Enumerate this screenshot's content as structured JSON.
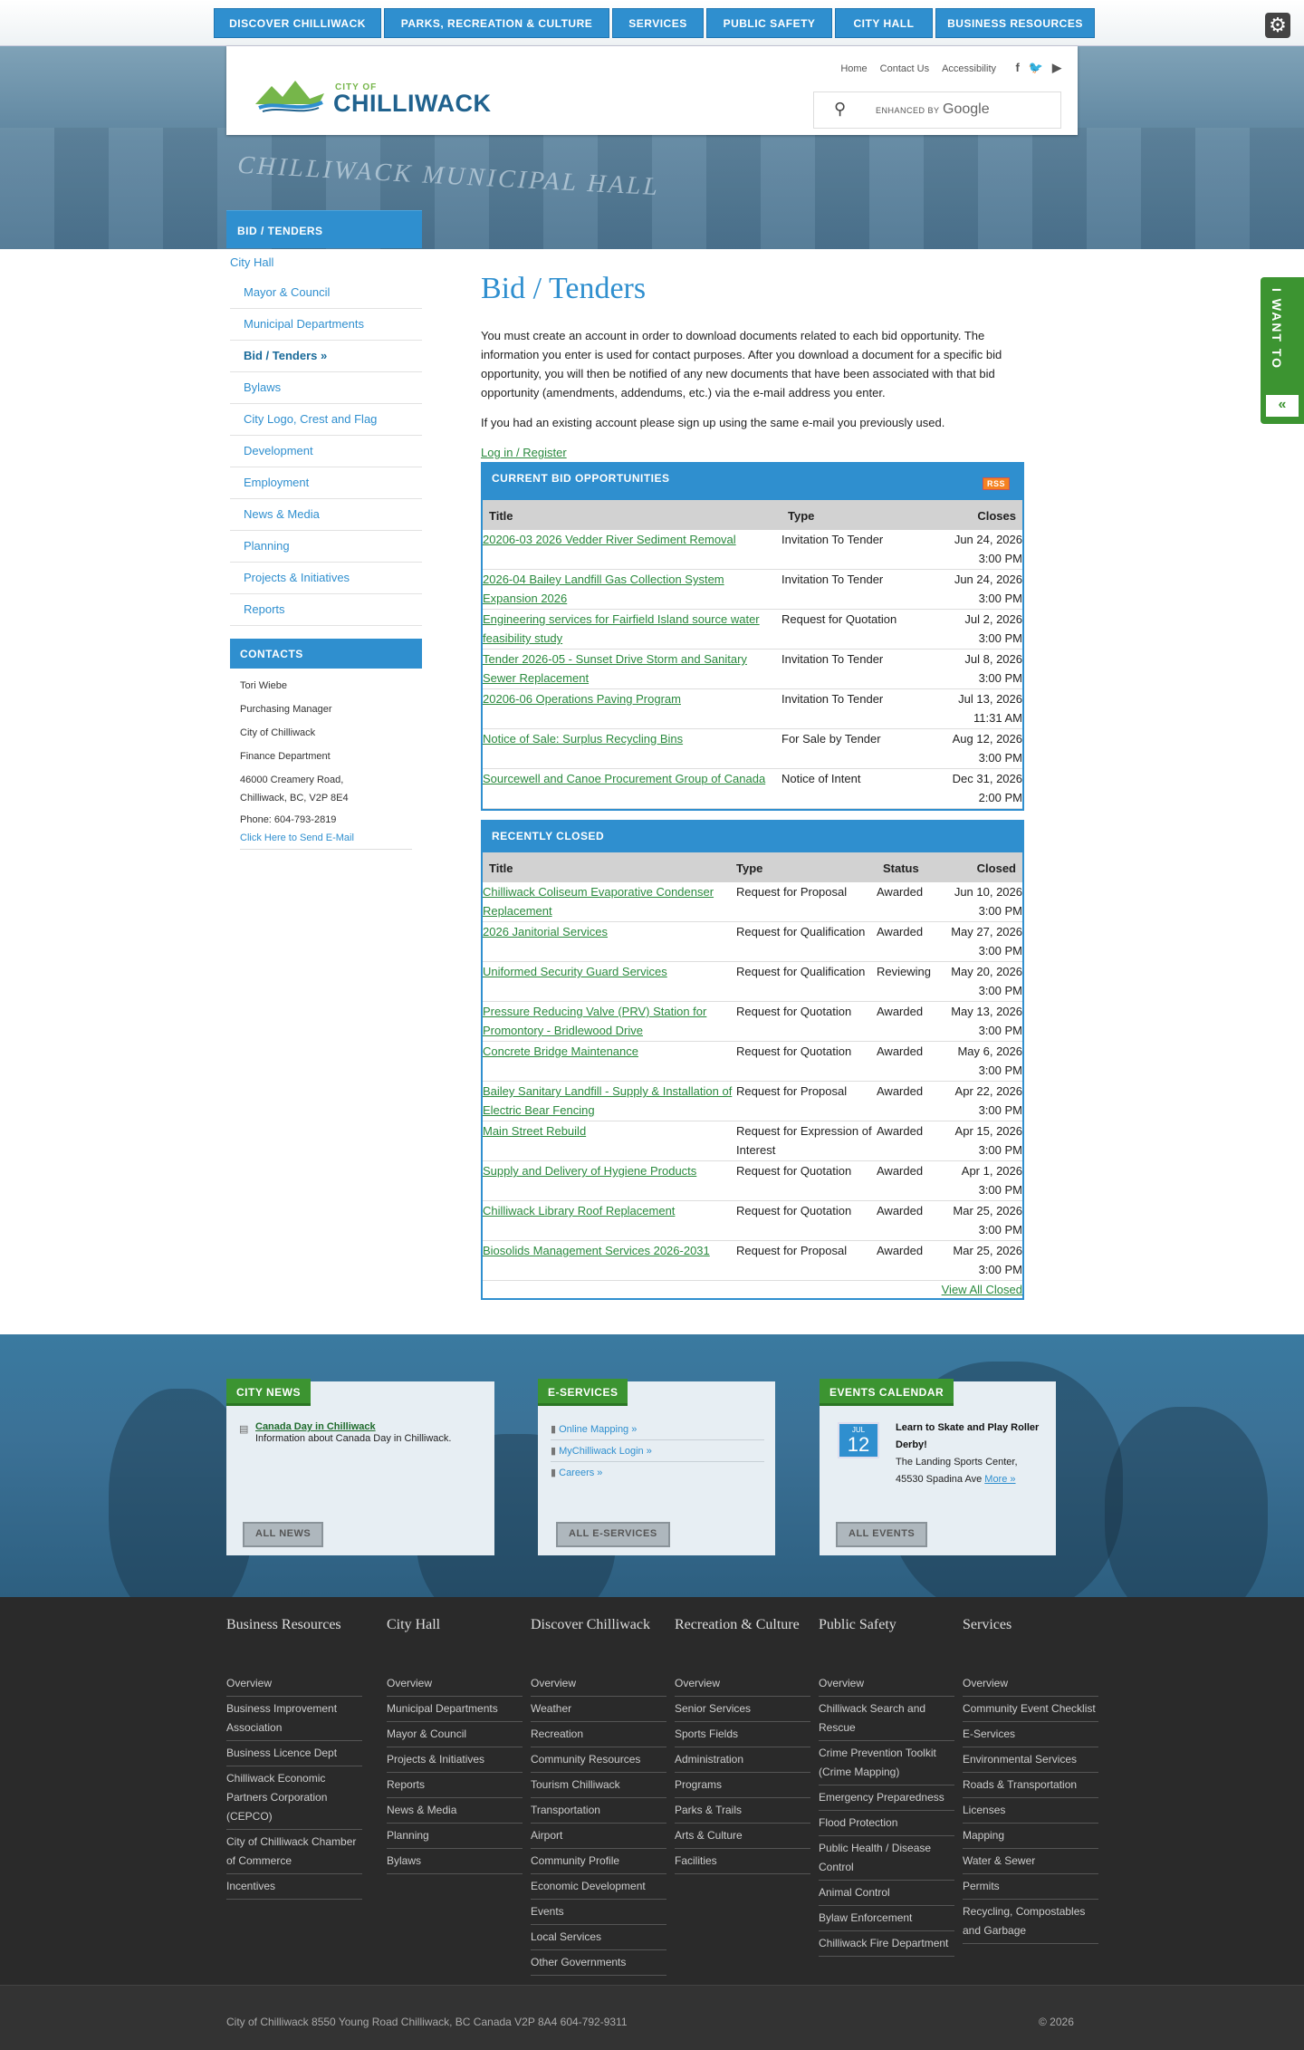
{
  "topnav": [
    "DISCOVER CHILLIWACK",
    "PARKS, RECREATION & CULTURE",
    "SERVICES",
    "PUBLIC SAFETY",
    "CITY HALL",
    "BUSINESS RESOURCES"
  ],
  "gear_icon": "gear-icon",
  "header": {
    "logo_small": "CITY OF",
    "logo_text": "CHILLIWACK",
    "util_links": [
      "Home",
      "Contact Us",
      "Accessibility"
    ],
    "socials": [
      "f",
      "t",
      "yt"
    ],
    "search_enhanced": "ENHANCED BY",
    "search_google": "Google"
  },
  "hero_sign": "CHILLIWACK MUNICIPAL HALL",
  "sidebar": {
    "header": "BID / TENDERS",
    "parent": "City Hall",
    "items": [
      "Mayor & Council",
      "Municipal Departments",
      "Bid / Tenders »",
      "Bylaws",
      "City Logo, Crest and Flag",
      "Development",
      "Employment",
      "News & Media",
      "Planning",
      "Projects & Initiatives",
      "Reports"
    ]
  },
  "contacts": {
    "header": "CONTACTS",
    "name": "Tori Wiebe",
    "role": "Purchasing Manager",
    "org": "City of Chilliwack",
    "dept": "Finance Department",
    "address1": "46000 Creamery Road,",
    "address2": "Chilliwack, BC, V2P 8E4",
    "phone": "Phone: 604-793-2819",
    "email_link": "Click Here to Send E-Mail"
  },
  "main": {
    "title": "Bid / Tenders",
    "para1": "You must create an account in order to download documents related to each bid opportunity.  The information you enter is used for contact purposes.  After you download a document for a specific bid opportunity, you will then be notified of any new documents that have been associated with that bid opportunity (amendments, addendums, etc.) via the e-mail address you enter.",
    "para2": "If you had an existing account please sign up using the same e-mail you previously used.",
    "login": "Log in / Register"
  },
  "current": {
    "header": "CURRENT BID OPPORTUNITIES",
    "rss": "RSS",
    "columns": [
      "Title",
      "Type",
      "Closes"
    ],
    "rows": [
      [
        "20206-03 2026 Vedder River Sediment Removal",
        "Invitation To Tender",
        "Jun 24, 2026",
        "3:00 PM"
      ],
      [
        "2026-04 Bailey Landfill Gas Collection System Expansion 2026",
        "Invitation To Tender",
        "Jun 24, 2026",
        "3:00 PM"
      ],
      [
        "Engineering services for Fairfield Island source water feasibility study",
        "Request for Quotation",
        "Jul 2, 2026",
        "3:00 PM"
      ],
      [
        "Tender 2026-05 - Sunset Drive Storm and Sanitary Sewer Replacement",
        "Invitation To Tender",
        "Jul 8, 2026",
        "3:00 PM"
      ],
      [
        "20206-06 Operations Paving Program",
        "Invitation To Tender",
        "Jul 13, 2026",
        "11:31 AM"
      ],
      [
        "Notice of Sale: Surplus Recycling Bins",
        "For Sale by Tender",
        "Aug 12, 2026",
        "3:00 PM"
      ],
      [
        "Sourcewell and Canoe Procurement Group of Canada",
        "Notice of Intent",
        "Dec 31, 2026",
        "2:00 PM"
      ]
    ]
  },
  "closed": {
    "header": "RECENTLY CLOSED",
    "columns": [
      "Title",
      "Type",
      "Status",
      "Closed"
    ],
    "rows": [
      [
        "Chilliwack Coliseum Evaporative Condenser Replacement",
        "Request for Proposal",
        "Awarded",
        "Jun 10, 2026",
        "3:00 PM"
      ],
      [
        "2026 Janitorial Services",
        "Request for Qualification",
        "Awarded",
        "May 27, 2026",
        "3:00 PM"
      ],
      [
        "Uniformed Security Guard Services",
        "Request for Qualification",
        "Reviewing",
        "May 20, 2026",
        "3:00 PM"
      ],
      [
        "Pressure Reducing Valve (PRV) Station for Promontory - Bridlewood Drive",
        "Request for Quotation",
        "Awarded",
        "May 13, 2026",
        "3:00 PM"
      ],
      [
        "Concrete Bridge Maintenance",
        "Request for Quotation",
        "Awarded",
        "May 6, 2026",
        "3:00 PM"
      ],
      [
        "Bailey Sanitary Landfill - Supply & Installation of Electric Bear Fencing",
        "Request for Proposal",
        "Awarded",
        "Apr 22, 2026",
        "3:00 PM"
      ],
      [
        "Main Street Rebuild",
        "Request for Expression of Interest",
        "Awarded",
        "Apr 15, 2026",
        "3:00 PM"
      ],
      [
        "Supply and Delivery of Hygiene Products",
        "Request for Quotation",
        "Awarded",
        "Apr 1, 2026",
        "3:00 PM"
      ],
      [
        "Chilliwack Library Roof Replacement",
        "Request for Quotation",
        "Awarded",
        "Mar 25, 2026",
        "3:00 PM"
      ],
      [
        "Biosolids Management Services 2026-2031",
        "Request for Proposal",
        "Awarded",
        "Mar 25, 2026",
        "3:00 PM"
      ]
    ],
    "view_all": "View All Closed"
  },
  "news": {
    "tab": "CITY NEWS",
    "item_title": "Canada Day in Chilliwack",
    "item_desc": "Information about Canada Day in Chilliwack.",
    "button": "ALL NEWS"
  },
  "eservices": {
    "tab": "E-SERVICES",
    "items": [
      "Online Mapping »",
      "MyChilliwack Login »",
      "Careers »"
    ],
    "button": "ALL E-SERVICES"
  },
  "events": {
    "tab": "EVENTS CALENDAR",
    "month": "JUL",
    "day": "12",
    "title": "Learn to Skate and Play Roller Derby!",
    "location": "The Landing Sports Center, 45530 Spadina Ave",
    "more": "More »",
    "button": "ALL EVENTS"
  },
  "iwant": {
    "label": "I WANT TO",
    "arrow": "«"
  },
  "footer": {
    "columns": [
      {
        "title": "Business Resources",
        "items": [
          "Overview",
          "Business Improvement Association",
          "Business Licence Dept",
          "Chilliwack Economic Partners Corporation (CEPCO)",
          "City of Chilliwack Chamber of Commerce",
          "Incentives"
        ]
      },
      {
        "title": "City Hall",
        "items": [
          "Overview",
          "Municipal Departments",
          "Mayor & Council",
          "Projects & Initiatives",
          "Reports",
          "News & Media",
          "Planning",
          "Bylaws"
        ]
      },
      {
        "title": "Discover Chilliwack",
        "items": [
          "Overview",
          "Weather",
          "Recreation",
          "Community Resources",
          "Tourism Chilliwack",
          "Transportation",
          "Airport",
          "Community Profile",
          "Economic Development",
          "Events",
          "Local Services",
          "Other Governments"
        ]
      },
      {
        "title": "Recreation & Culture",
        "items": [
          "Overview",
          "Senior Services",
          "Sports Fields",
          "Administration",
          "Programs",
          "Parks & Trails",
          "Arts & Culture",
          "Facilities"
        ]
      },
      {
        "title": "Public Safety",
        "items": [
          "Overview",
          "Chilliwack Search and Rescue",
          "Crime Prevention Toolkit (Crime Mapping)",
          "Emergency Preparedness",
          "Flood Protection",
          "Public Health / Disease Control",
          "Animal Control",
          "Bylaw Enforcement",
          "Chilliwack Fire Department"
        ]
      },
      {
        "title": "Services",
        "items": [
          "Overview",
          "Community Event Checklist",
          "E-Services",
          "Environmental Services",
          "Roads & Transportation",
          "Licenses",
          "Mapping",
          "Water & Sewer",
          "Permits",
          "Recycling, Compostables and Garbage"
        ]
      }
    ],
    "address": "City of Chilliwack 8550 Young Road Chilliwack, BC Canada V2P 8A4  604-792-9311",
    "copyright": "© 2026"
  }
}
